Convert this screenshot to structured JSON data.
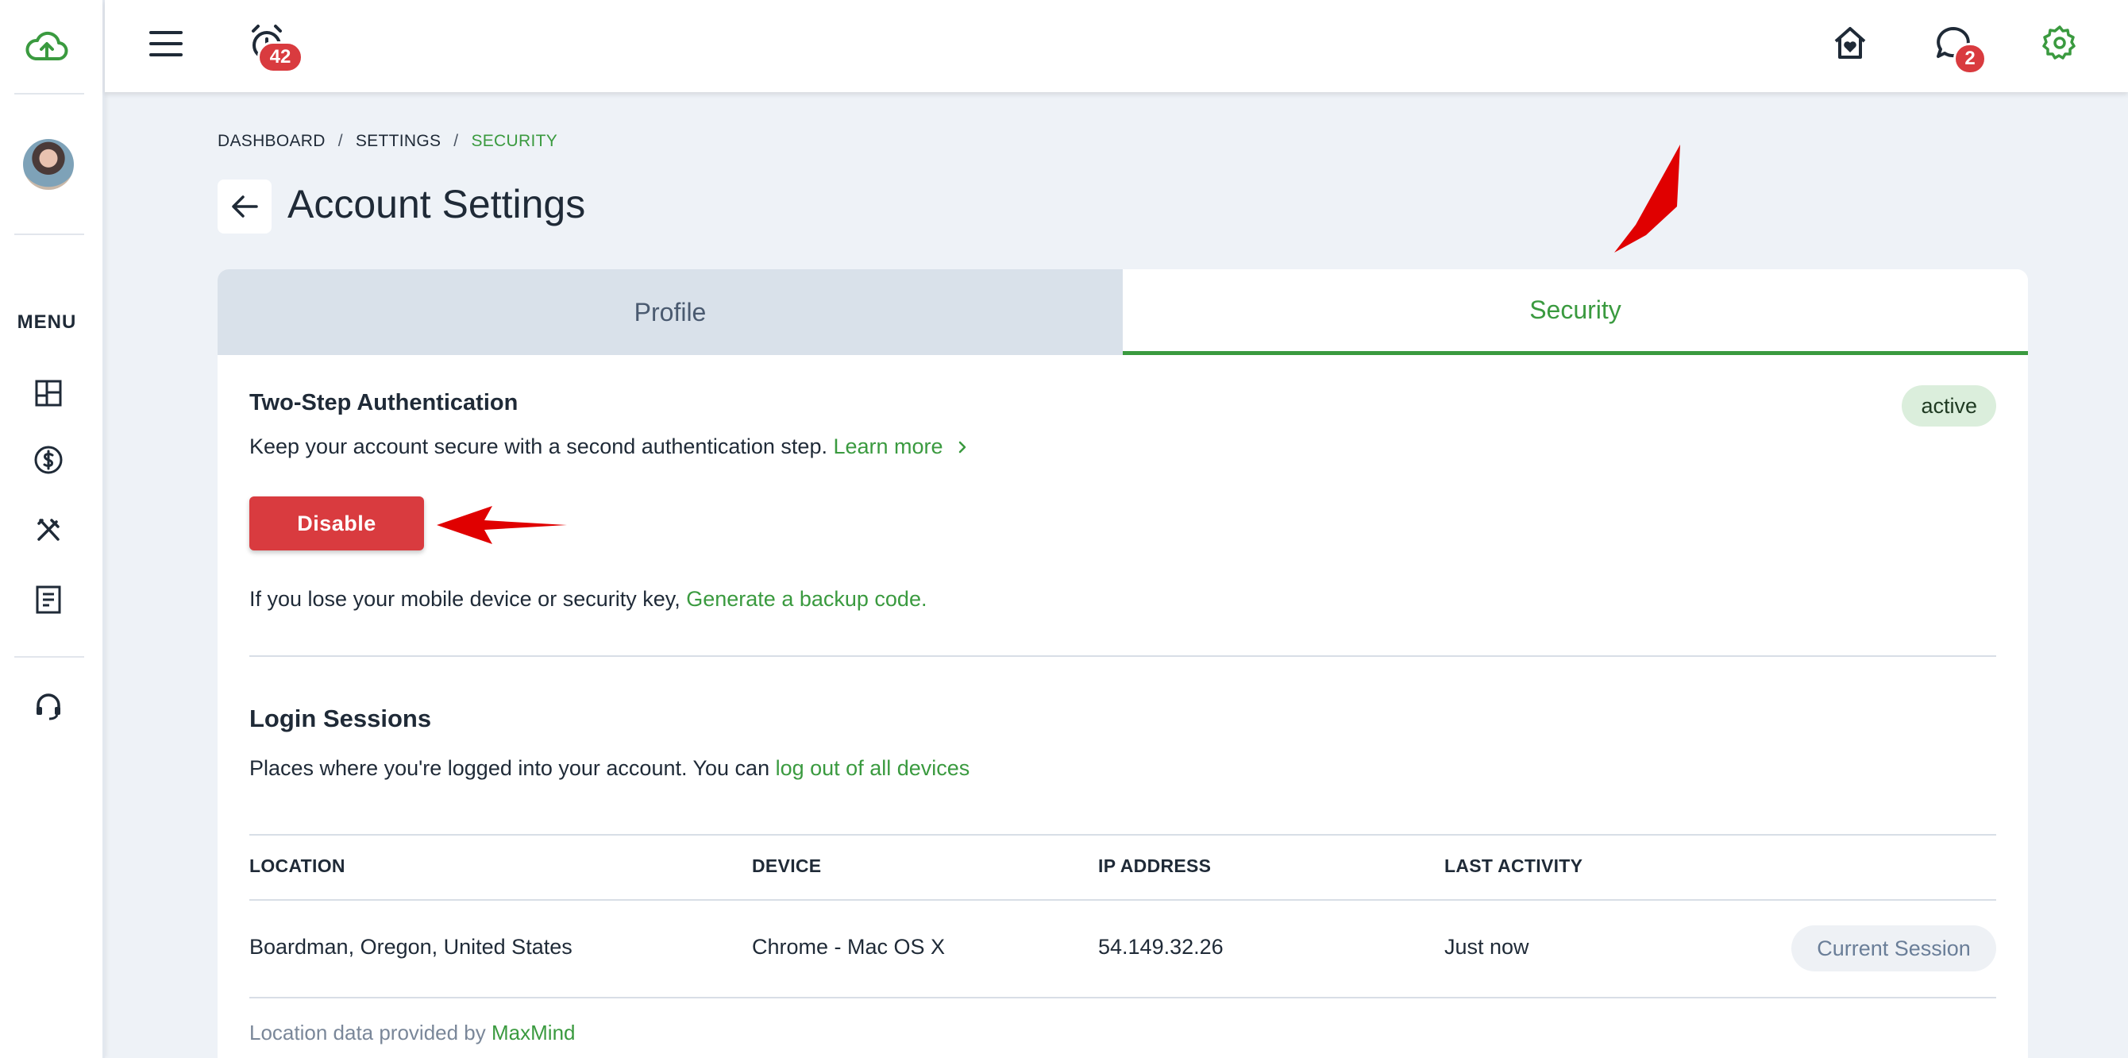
{
  "topbar": {
    "alerts_badge": "42",
    "messages_badge": "2"
  },
  "sidebar": {
    "menu_label": "MENU"
  },
  "breadcrumb": {
    "items": [
      "DASHBOARD",
      "SETTINGS",
      "SECURITY"
    ],
    "separator": "/"
  },
  "page": {
    "title": "Account Settings"
  },
  "tabs": {
    "profile": "Profile",
    "security": "Security"
  },
  "two_step": {
    "title": "Two-Step Authentication",
    "status": "active",
    "description": "Keep your account secure with a second authentication step.",
    "learn_more": "Learn more",
    "disable_label": "Disable",
    "backup_text": "If you lose your mobile device or security key,",
    "backup_link": "Generate a backup code."
  },
  "sessions": {
    "title": "Login Sessions",
    "description": "Places where you're logged into your account. You can",
    "logout_link": "log out of all devices",
    "columns": [
      "LOCATION",
      "DEVICE",
      "IP ADDRESS",
      "LAST ACTIVITY"
    ],
    "rows": [
      {
        "location": "Boardman, Oregon, United States",
        "device": "Chrome - Mac OS X",
        "ip": "54.149.32.26",
        "last_activity": "Just now",
        "action": "Current Session"
      }
    ],
    "footnote": "Location data provided by",
    "footnote_link": "MaxMind"
  },
  "colors": {
    "accent": "#3a9a3f",
    "danger": "#d93b3f",
    "annotation": "#e00000"
  }
}
